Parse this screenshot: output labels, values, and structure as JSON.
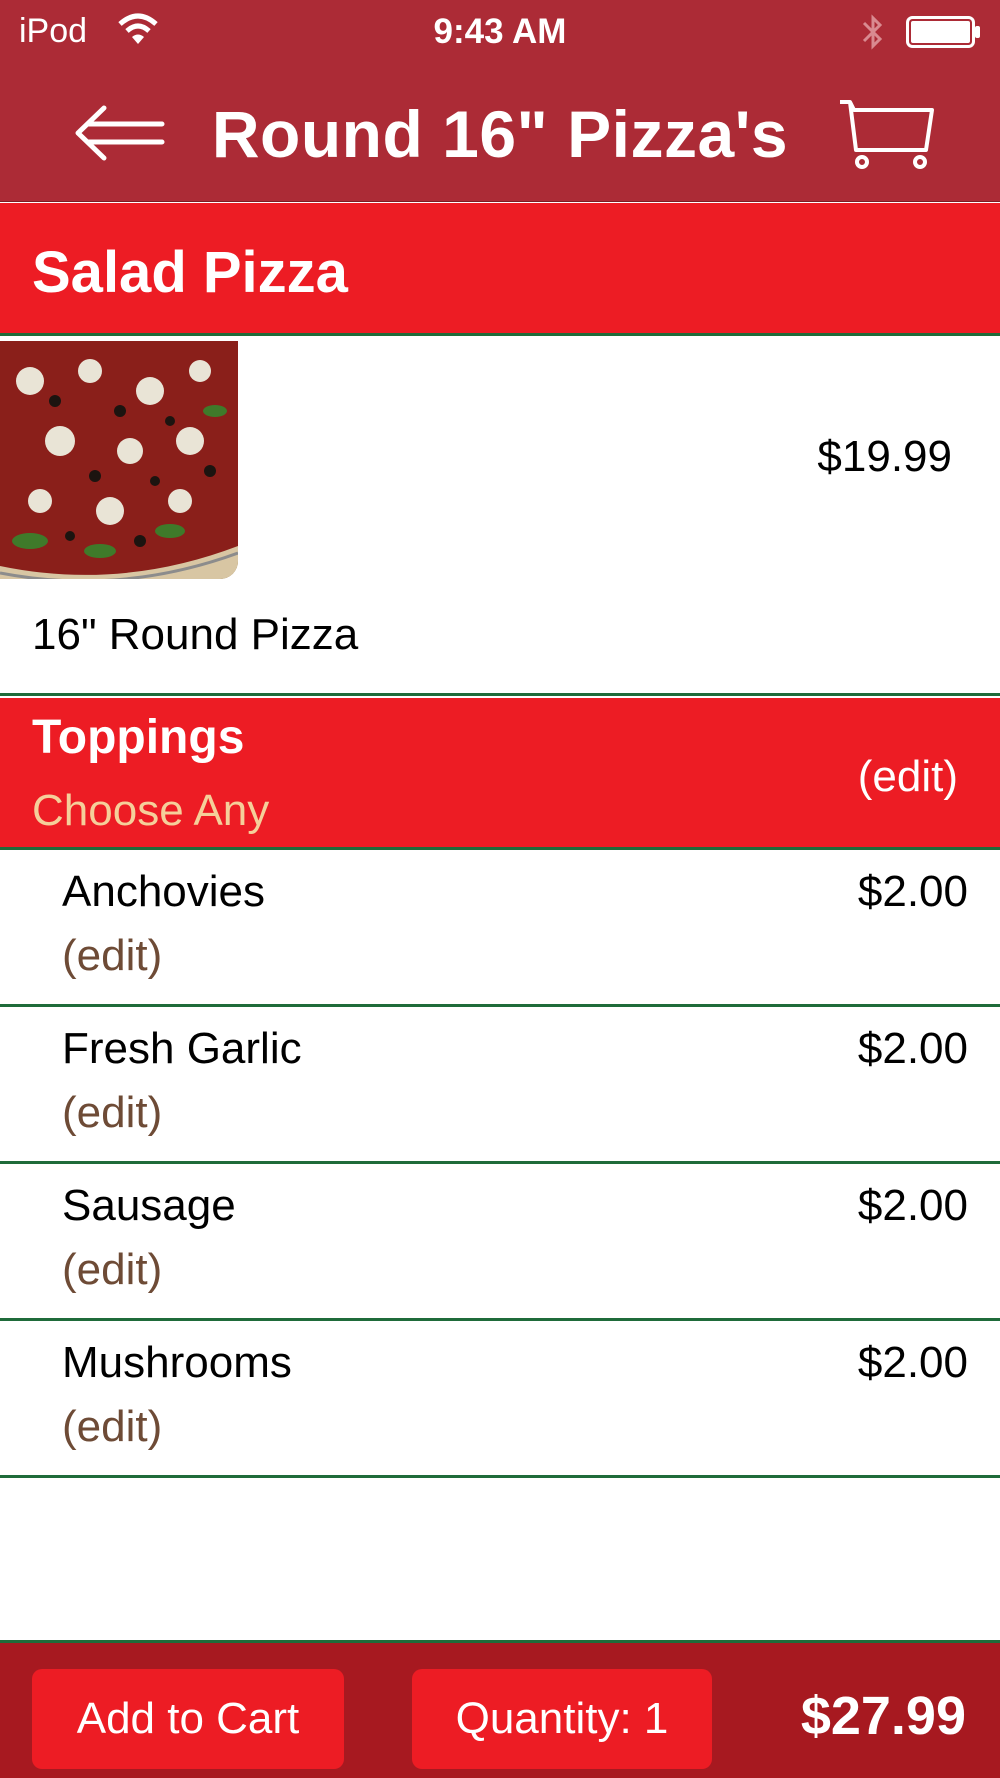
{
  "status_bar": {
    "carrier": "iPod",
    "time": "9:43 AM",
    "icons": [
      "wifi-icon",
      "bluetooth-icon",
      "battery-icon"
    ]
  },
  "nav": {
    "title": "Round 16\" Pizza's",
    "back_icon": "back-arrow-icon",
    "cart_icon": "cart-icon"
  },
  "item": {
    "name": "Salad Pizza",
    "price": "$19.99",
    "size": "16\" Round Pizza",
    "image": "pizza-photo"
  },
  "toppings": {
    "title": "Toppings",
    "subtitle": "Choose Any",
    "edit_label": "(edit)",
    "items": [
      {
        "name": "Anchovies",
        "price": "$2.00",
        "edit": "(edit)"
      },
      {
        "name": "Fresh Garlic",
        "price": "$2.00",
        "edit": "(edit)"
      },
      {
        "name": "Sausage",
        "price": "$2.00",
        "edit": "(edit)"
      },
      {
        "name": "Mushrooms",
        "price": "$2.00",
        "edit": "(edit)"
      }
    ]
  },
  "footer": {
    "add_to_cart": "Add to Cart",
    "quantity": "Quantity: 1",
    "total": "$27.99"
  },
  "colors": {
    "nav_bg": "#ac2b36",
    "header_red": "#ed1c24",
    "footer_bg": "#a71920",
    "divider_green": "#1f6b3a",
    "subtitle_tan": "#f5cf9a",
    "edit_brown": "#6e4b36"
  }
}
